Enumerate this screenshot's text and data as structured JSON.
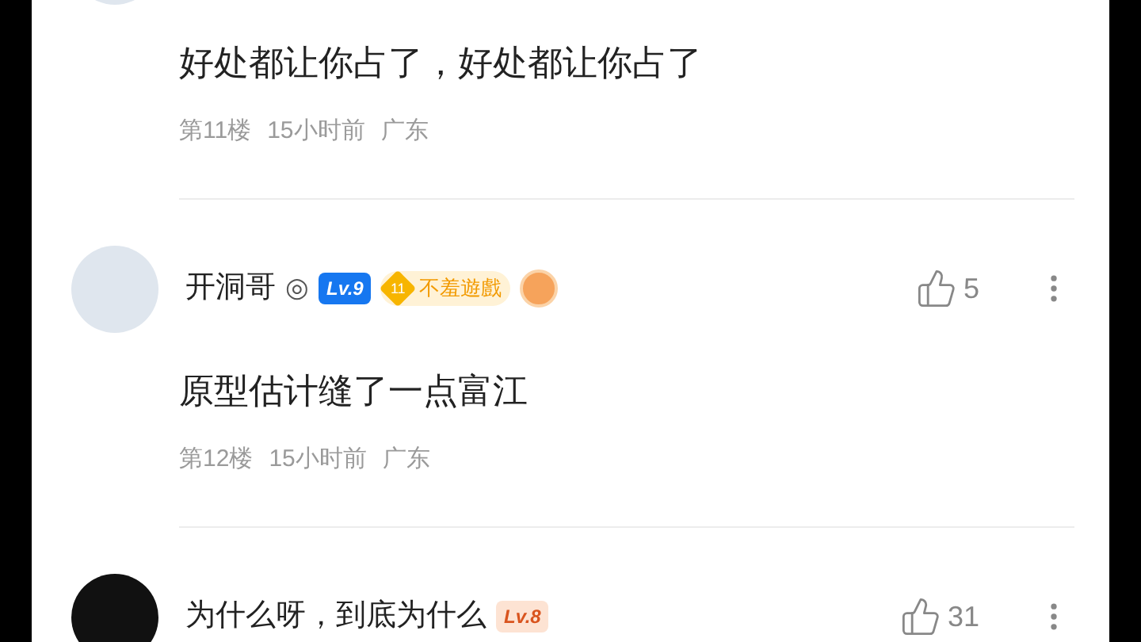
{
  "comments": [
    {
      "kind": "light",
      "text": "好处都让你占了，好处都让你占了",
      "floor": "第11楼",
      "time": "15小时前",
      "location": "广东"
    },
    {
      "kind": "light",
      "name": "开洞哥",
      "name_mark": "◎",
      "level": {
        "text": "Lv.9",
        "color": "#1677f0"
      },
      "fan_badge": {
        "number": "11",
        "label": "不羞遊戲"
      },
      "likes": "5",
      "text": "原型估计缝了一点富江",
      "floor": "第12楼",
      "time": "15小时前",
      "location": "广东"
    },
    {
      "kind": "dark",
      "name": "为什么呀，到底为什么",
      "level": {
        "text": "Lv.8",
        "color": "#fde3d3"
      },
      "likes": "31"
    }
  ]
}
